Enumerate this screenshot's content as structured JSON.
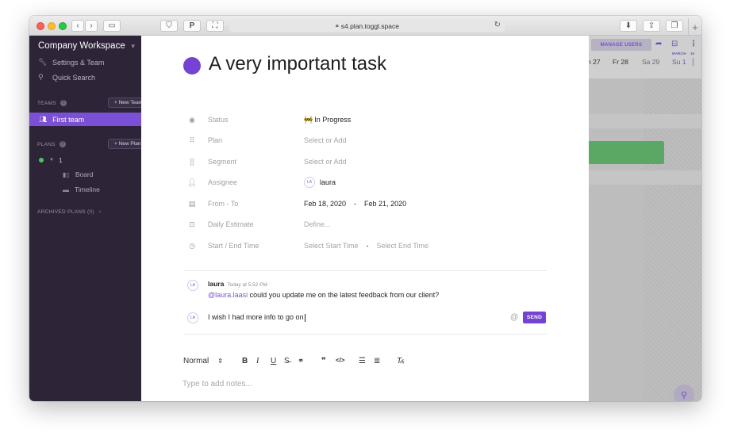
{
  "browser": {
    "url": "s4.plan.toggl.space",
    "lock_icon": "lock-icon"
  },
  "sidebar": {
    "workspace_title": "Company Workspace",
    "links": [
      {
        "label": "Settings & Team",
        "icon": "wrench-icon"
      },
      {
        "label": "Quick Search",
        "icon": "search-icon"
      }
    ],
    "teams_section": "TEAMS",
    "new_team_label": "+ New Team",
    "team_item": "First team",
    "plans_section": "PLANS",
    "new_plan_label": "+ New Plan",
    "plan_item": "1",
    "plan_children": [
      {
        "label": "Board",
        "icon": "board-icon"
      },
      {
        "label": "Timeline",
        "icon": "timeline-icon"
      }
    ],
    "archived_label": "ARCHIVED PLANS (0)"
  },
  "task": {
    "title": "A very important task",
    "color": "#7443d3",
    "fields": [
      {
        "label": "Status",
        "value": "In Progress",
        "icon": "status-icon"
      },
      {
        "label": "Plan",
        "value": "Select or Add",
        "icon": "plan-icon"
      },
      {
        "label": "Segment",
        "value": "Select or Add",
        "icon": "segment-icon"
      },
      {
        "label": "Assignee",
        "value": "laura",
        "icon": "assignee-icon"
      },
      {
        "label": "From - To",
        "from": "Feb 18, 2020",
        "to": "Feb 21, 2020",
        "icon": "calendar-icon"
      },
      {
        "label": "Daily Estimate",
        "value": "Define...",
        "icon": "estimate-icon"
      },
      {
        "label": "Start / End Time",
        "start": "Select Start Time",
        "end": "Select End Time",
        "icon": "clock-icon"
      }
    ],
    "status_emoji": "🚧",
    "assignee_initials": "LA"
  },
  "comment": {
    "author": "laura",
    "time": "Today at 5:52 PM",
    "mention": "@laura.laasi",
    "text": " could you update me on the latest feedback from our client?",
    "initials": "LA"
  },
  "reply": {
    "text": "I wish I had more info to go on",
    "initials": "LA",
    "send_label": "SEND"
  },
  "editor": {
    "format_label": "Normal",
    "notes_placeholder": "Type to add notes..."
  },
  "timeline": {
    "manage_users_label": "MANAGE USERS",
    "month_label": "MARCH",
    "month_label_2": "10",
    "days": [
      "h 27",
      "Fr 28",
      "Sa 29",
      "Su 1"
    ],
    "bar_color": "#5ba865"
  }
}
